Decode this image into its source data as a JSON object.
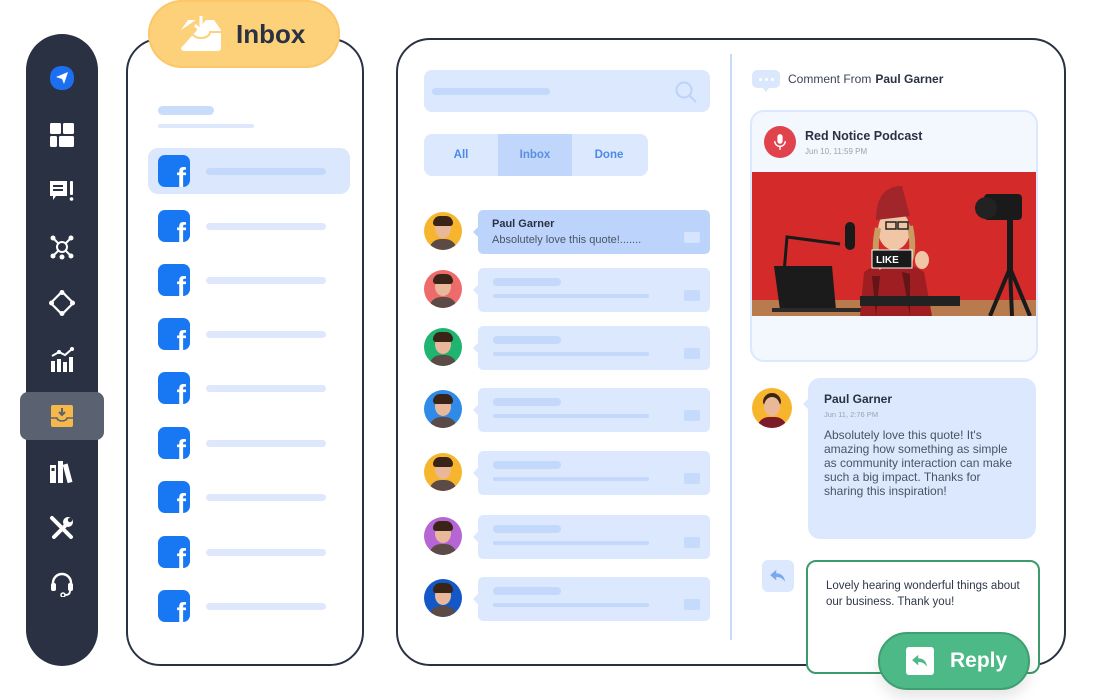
{
  "sidebar": {
    "items": [
      {
        "icon": "send-icon",
        "label": "Publish",
        "active": false
      },
      {
        "icon": "dashboard-icon",
        "label": "Dashboard",
        "active": false
      },
      {
        "icon": "feedback-icon",
        "label": "Feedback",
        "active": false
      },
      {
        "icon": "network-icon",
        "label": "Connections",
        "active": false
      },
      {
        "icon": "workflow-icon",
        "label": "Workflow",
        "active": false
      },
      {
        "icon": "analytics-icon",
        "label": "Analytics",
        "active": false
      },
      {
        "icon": "inbox-icon",
        "label": "Inbox",
        "active": true
      },
      {
        "icon": "library-icon",
        "label": "Library",
        "active": false
      },
      {
        "icon": "tools-icon",
        "label": "Tools",
        "active": false
      },
      {
        "icon": "support-icon",
        "label": "Support",
        "active": false
      }
    ]
  },
  "inbox_panel": {
    "title": "Inbox",
    "accounts": [
      {
        "platform": "facebook",
        "active": true
      },
      {
        "platform": "facebook",
        "active": false
      },
      {
        "platform": "facebook",
        "active": false
      },
      {
        "platform": "facebook",
        "active": false
      },
      {
        "platform": "facebook",
        "active": false
      },
      {
        "platform": "facebook",
        "active": false
      },
      {
        "platform": "facebook",
        "active": false
      },
      {
        "platform": "facebook",
        "active": false
      },
      {
        "platform": "facebook",
        "active": false
      }
    ],
    "fb_glyph": "f"
  },
  "conversations": {
    "tabs": [
      {
        "label": "All",
        "active": false
      },
      {
        "label": "Inbox",
        "active": true
      },
      {
        "label": "Done",
        "active": false
      }
    ],
    "items": [
      {
        "name": "Paul Garner",
        "preview": "Absolutely love this quote!.......",
        "active": true,
        "avatar_bg": "#f6b52d"
      },
      {
        "name": "",
        "preview": "",
        "active": false,
        "avatar_bg": "#ee6b6b"
      },
      {
        "name": "",
        "preview": "",
        "active": false,
        "avatar_bg": "#1fb46f"
      },
      {
        "name": "",
        "preview": "",
        "active": false,
        "avatar_bg": "#2f8ae8"
      },
      {
        "name": "",
        "preview": "",
        "active": false,
        "avatar_bg": "#f6b52d"
      },
      {
        "name": "",
        "preview": "",
        "active": false,
        "avatar_bg": "#b566d4"
      },
      {
        "name": "",
        "preview": "",
        "active": false,
        "avatar_bg": "#1458c8"
      }
    ]
  },
  "detail": {
    "comment_prefix": "Comment From",
    "comment_author": "Paul Garner",
    "post": {
      "title": "Red Notice Podcast",
      "time": "Jun 10, 11:59 PM",
      "image_sign": "LIKE"
    },
    "comment": {
      "author": "Paul Garner",
      "time": "Jun 11, 2:76 PM",
      "body": "Absolutely love this quote! It's amazing how something as simple as community interaction can make such a big impact. Thanks for sharing this inspiration!"
    },
    "reply_text": "Lovely hearing wonderful things about our business. Thank you!",
    "reply_button": "Reply"
  },
  "colors": {
    "sidebar_bg": "#2a3142",
    "accent_blue": "#4b8ae8",
    "inbox_pill": "#fdd07a",
    "reply_green": "#4cb987",
    "facebook": "#1877f2"
  }
}
